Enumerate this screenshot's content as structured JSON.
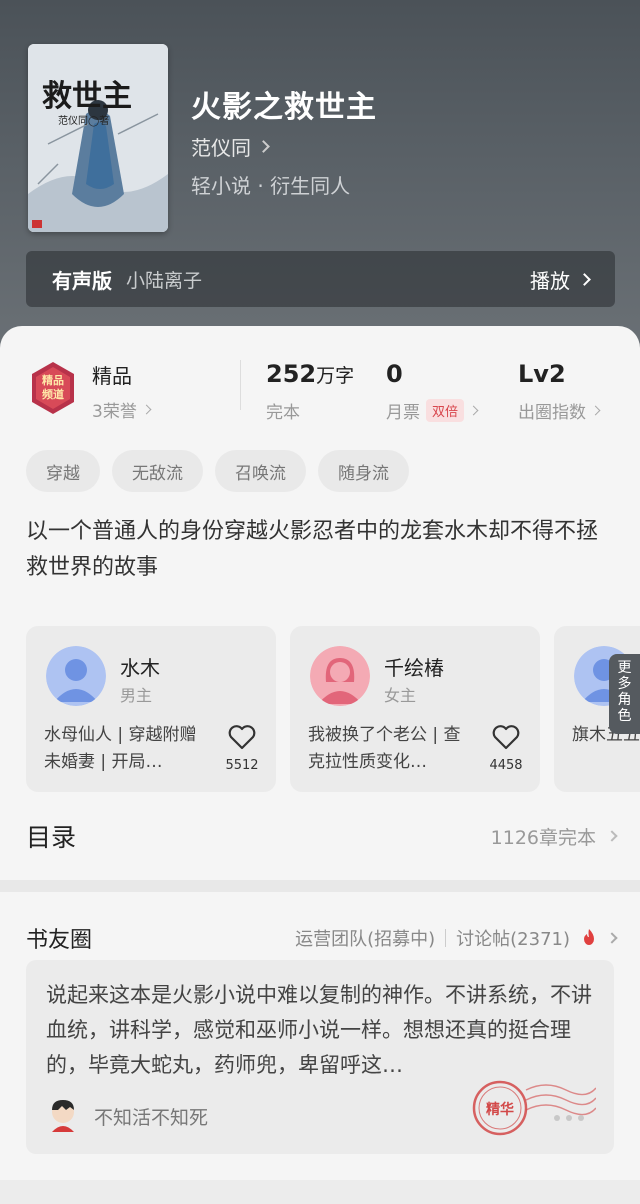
{
  "book": {
    "title": "火影之救世主",
    "author": "范仪同",
    "genre": "轻小说 · 衍生同人",
    "cover_title": "救世主",
    "cover_author": "范仪同◯著"
  },
  "audio": {
    "label": "有声版",
    "narrator": "小陆离子",
    "play_label": "播放"
  },
  "stats": {
    "badge_label": "精品",
    "badge_art_text": "精品频道",
    "honors": "3荣誉",
    "word_count": "252",
    "word_unit": "万字",
    "status": "完本",
    "monthly_tickets": "0",
    "monthly_label": "月票",
    "double_badge": "双倍",
    "level": "Lv2",
    "level_label": "出圈指数"
  },
  "tags": [
    "穿越",
    "无敌流",
    "召唤流",
    "随身流"
  ],
  "synopsis": "以一个普通人的身份穿越火影忍者中的龙套水木却不得不拯救世界的故事",
  "characters": [
    {
      "name": "水木",
      "role": "男主",
      "desc": "水母仙人 | 穿越附赠未婚妻 | 开局…",
      "likes": "5512",
      "avatar_color": "#7b9ce6"
    },
    {
      "name": "千绘椿",
      "role": "女主",
      "desc": "我被换了个老公 | 查克拉性质变化…",
      "likes": "4458",
      "avatar_color": "#ea7c8b"
    },
    {
      "name": "",
      "role": "",
      "desc": "旗木五五 | 可以轻易",
      "likes": "",
      "avatar_color": "#7b9ce6"
    }
  ],
  "more_characters": "更多角色",
  "toc": {
    "title": "目录",
    "info": "1126章完本"
  },
  "circle": {
    "title": "书友圈",
    "ops_link": "运营团队(招募中)",
    "discussion_link": "讨论帖(2371)",
    "post_text": "说起来这本是火影小说中难以复制的神作。不讲系统，不讲血统，讲科学，感觉和巫师小说一样。想想还真的挺合理的，毕竟大蛇丸，药师兜，卑留呼这…",
    "post_user": "不知活不知死",
    "stamp_label": "精华"
  },
  "colors": {
    "header_bg": "#545b61",
    "accent_red": "#d8454c",
    "male_avatar": "#7b9ce6",
    "female_avatar": "#ea7c8b"
  }
}
